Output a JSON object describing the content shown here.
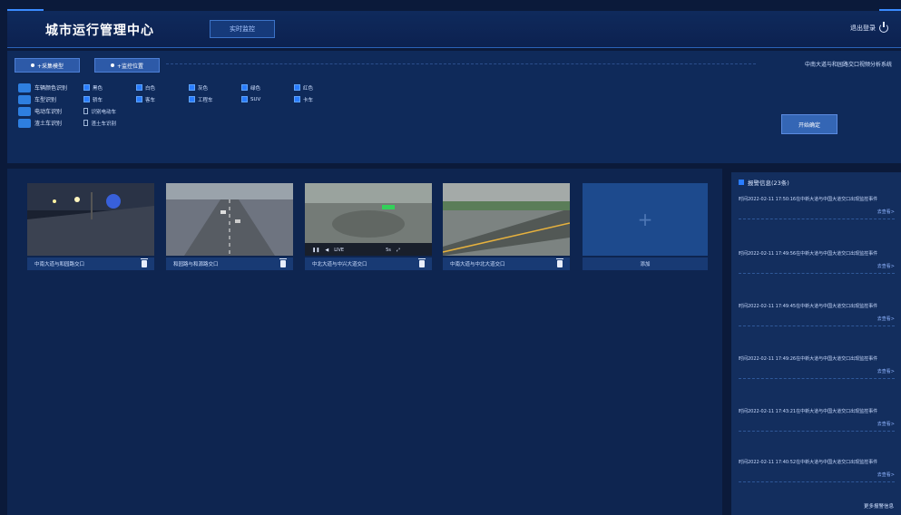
{
  "header": {
    "title": "城市运行管理中心",
    "tab_label": "实时监控",
    "user_label": "退出登录"
  },
  "controls": {
    "btn1": "+采集模型",
    "btn2": "+监控位置",
    "top_right_text": "中南大道与和园路交口视频分析系统",
    "confirm_label": "开始确定",
    "rows": [
      {
        "label": "车辆颜色识别",
        "opts": [
          [
            "黑色",
            true
          ],
          [
            "白色",
            true
          ],
          [
            "灰色",
            true
          ],
          [
            "绿色",
            true
          ],
          [
            "红色",
            true
          ]
        ]
      },
      {
        "label": "车型识别",
        "opts": [
          [
            "轿车",
            true
          ],
          [
            "客车",
            true
          ],
          [
            "工程车",
            true
          ],
          [
            "SUV",
            true
          ],
          [
            "卡车",
            true
          ]
        ]
      },
      {
        "label": "电动车识别",
        "opts": [
          [
            "识别电动车",
            false
          ]
        ]
      },
      {
        "label": "渣土车识别",
        "opts": [
          [
            "渣土车识别",
            false
          ]
        ]
      }
    ]
  },
  "cameras": [
    {
      "label": "中南大道与和园路交口"
    },
    {
      "label": "和园路与和源路交口"
    },
    {
      "label": "中北大道与中兴大道交口"
    },
    {
      "label": "中南大道与中北大道交口"
    }
  ],
  "add_label": "添加",
  "video_controls": {
    "live": "LIVE",
    "time": "5s"
  },
  "panel": {
    "title": "报警信息(23条)",
    "link": "去查看>",
    "more": "更多报警信息",
    "alerts": [
      "时间2022-02-11 17:50:16在中新大道与中国大道交口出现监控事件",
      "时间2022-02-11 17:49:56在中新大道与中国大道交口出现监控事件",
      "时间2022-02-11 17:49:45在中新大道与中国大道交口出现监控事件",
      "时间2022-02-11 17:49:26在中新大道与中国大道交口出现监控事件",
      "时间2022-02-11 17:43:21在中新大道与中国大道交口出现监控事件",
      "时间2022-02-11 17:40:52在中新大道与中国大道交口出现监控事件"
    ]
  }
}
